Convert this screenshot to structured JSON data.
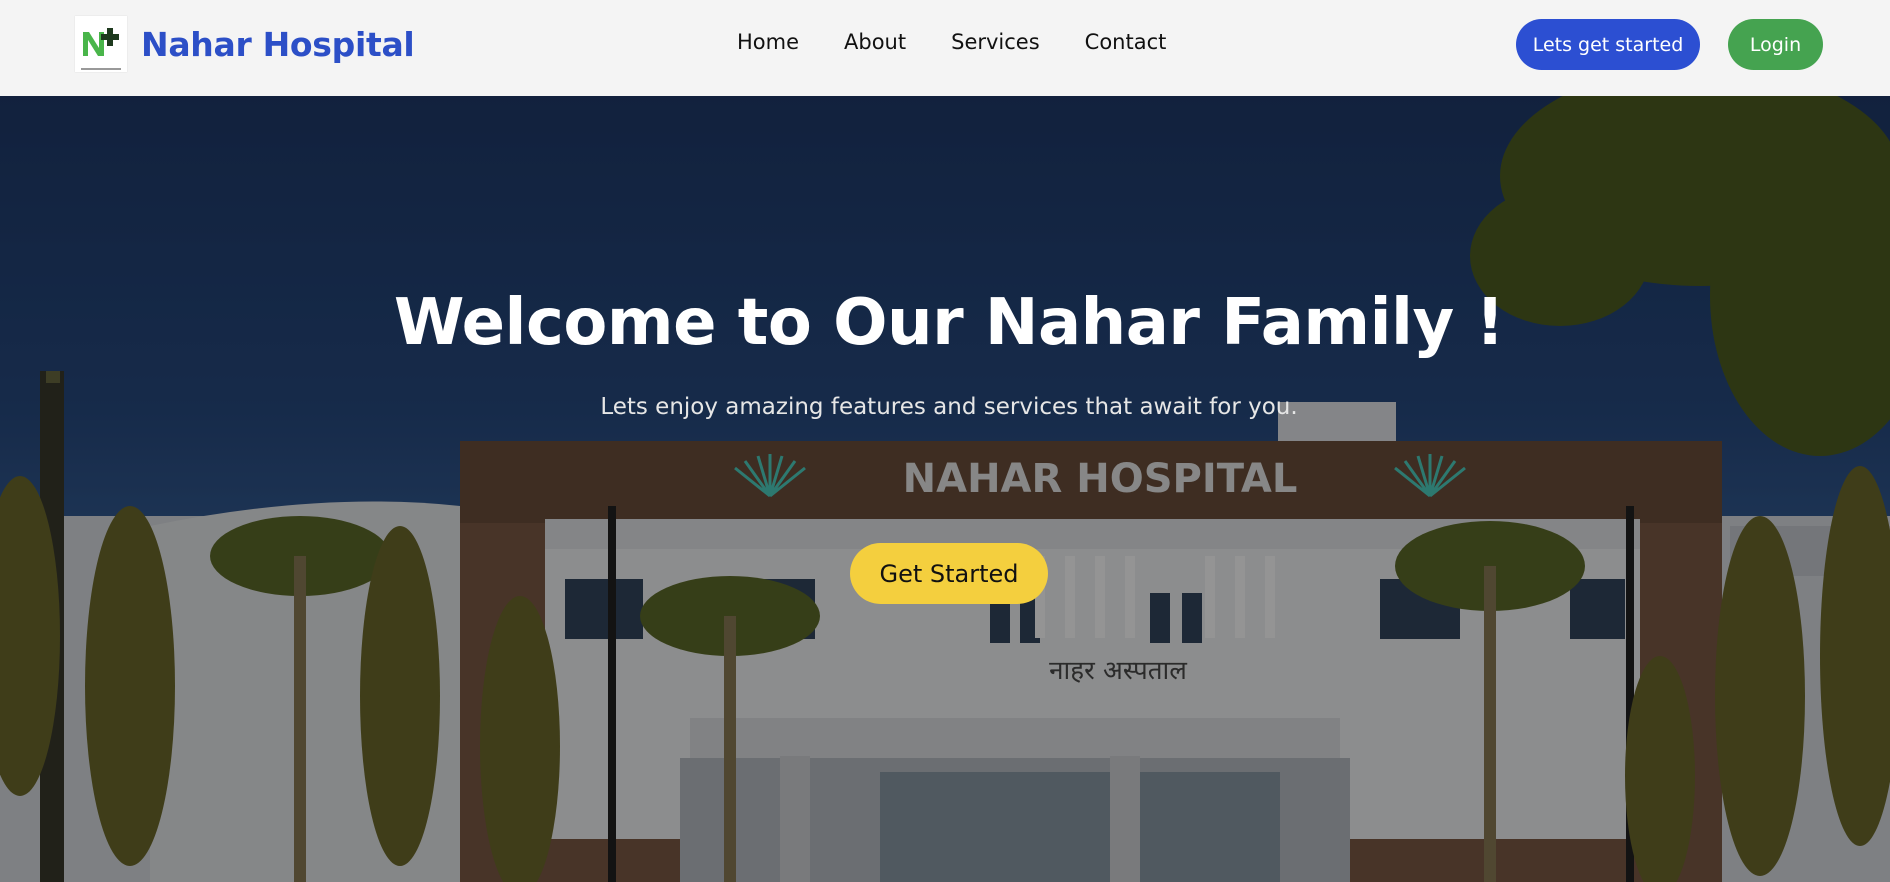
{
  "brand": {
    "name": "Nahar Hospital",
    "logo_icon": "hospital-cross-logo-icon"
  },
  "nav": {
    "links": [
      "Home",
      "About",
      "Services",
      "Contact"
    ],
    "cta_label": "Lets get started",
    "login_label": "Login"
  },
  "hero": {
    "title": "Welcome to Our Nahar Family !",
    "subtitle": "Lets enjoy amazing features and services that await for you.",
    "button_label": "Get Started",
    "building_sign": "NAHAR HOSPITAL",
    "building_sign_local": "नाहर अस्पताल"
  },
  "colors": {
    "brand_blue": "#2c4fc7",
    "start_button": "#2c4fd2",
    "login_button": "#45a350",
    "cta_yellow": "#f4cf3e"
  }
}
